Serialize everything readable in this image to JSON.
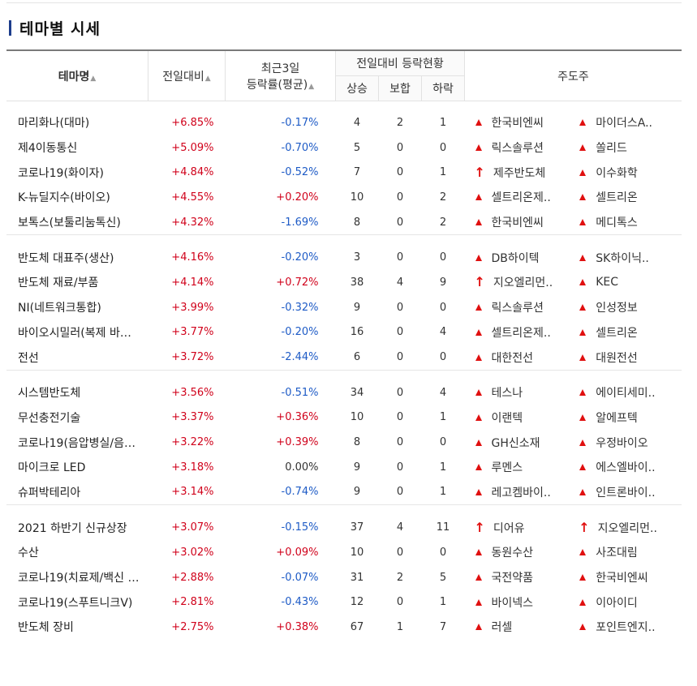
{
  "title": "테마별 시세",
  "header": {
    "theme": "테마명",
    "change": "전일대비",
    "rate3d_line1": "최근3일",
    "rate3d_line2": "등락률(평균)",
    "group": "전일대비 등락현황",
    "up": "상승",
    "same": "보합",
    "down": "하락",
    "leaders": "주도주",
    "sort_glyph": "▲"
  },
  "colors": {
    "up": "#d0021b",
    "down": "#1e5bc6",
    "accent": "#1d3d8c"
  },
  "groups": [
    [
      {
        "theme": "마리화나(대마)",
        "change": "+6.85%",
        "rate3d": "-0.17%",
        "up": "4",
        "same": "2",
        "down": "1",
        "leaders": [
          {
            "name": "한국비엔씨",
            "icon": "rise-icon"
          },
          {
            "name": "마이더스A..",
            "icon": "rise-icon"
          }
        ]
      },
      {
        "theme": "제4이동통신",
        "change": "+5.09%",
        "rate3d": "-0.70%",
        "up": "5",
        "same": "0",
        "down": "0",
        "leaders": [
          {
            "name": "릭스솔루션",
            "icon": "rise-icon"
          },
          {
            "name": "쏠리드",
            "icon": "rise-icon"
          }
        ]
      },
      {
        "theme": "코로나19(화이자)",
        "change": "+4.84%",
        "rate3d": "-0.52%",
        "up": "7",
        "same": "0",
        "down": "1",
        "leaders": [
          {
            "name": "제주반도체",
            "icon": "upper-limit-icon"
          },
          {
            "name": "이수화학",
            "icon": "rise-icon"
          }
        ]
      },
      {
        "theme": "K-뉴딜지수(바이오)",
        "change": "+4.55%",
        "rate3d": "+0.20%",
        "up": "10",
        "same": "0",
        "down": "2",
        "leaders": [
          {
            "name": "셀트리온제..",
            "icon": "rise-icon"
          },
          {
            "name": "셀트리온",
            "icon": "rise-icon"
          }
        ]
      },
      {
        "theme": "보톡스(보툴리눔톡신)",
        "change": "+4.32%",
        "rate3d": "-1.69%",
        "up": "8",
        "same": "0",
        "down": "2",
        "leaders": [
          {
            "name": "한국비엔씨",
            "icon": "rise-icon"
          },
          {
            "name": "메디톡스",
            "icon": "rise-icon"
          }
        ]
      }
    ],
    [
      {
        "theme": "반도체 대표주(생산)",
        "change": "+4.16%",
        "rate3d": "-0.20%",
        "up": "3",
        "same": "0",
        "down": "0",
        "leaders": [
          {
            "name": "DB하이텍",
            "icon": "rise-icon"
          },
          {
            "name": "SK하이닉..",
            "icon": "rise-icon"
          }
        ]
      },
      {
        "theme": "반도체 재료/부품",
        "change": "+4.14%",
        "rate3d": "+0.72%",
        "up": "38",
        "same": "4",
        "down": "9",
        "leaders": [
          {
            "name": "지오엘리먼..",
            "icon": "upper-limit-icon"
          },
          {
            "name": "KEC",
            "icon": "rise-icon"
          }
        ]
      },
      {
        "theme": "NI(네트워크통합)",
        "change": "+3.99%",
        "rate3d": "-0.32%",
        "up": "9",
        "same": "0",
        "down": "0",
        "leaders": [
          {
            "name": "릭스솔루션",
            "icon": "rise-icon"
          },
          {
            "name": "인성정보",
            "icon": "rise-icon"
          }
        ]
      },
      {
        "theme": "바이오시밀러(복제 바…",
        "change": "+3.77%",
        "rate3d": "-0.20%",
        "up": "16",
        "same": "0",
        "down": "4",
        "leaders": [
          {
            "name": "셀트리온제..",
            "icon": "rise-icon"
          },
          {
            "name": "셀트리온",
            "icon": "rise-icon"
          }
        ]
      },
      {
        "theme": "전선",
        "change": "+3.72%",
        "rate3d": "-2.44%",
        "up": "6",
        "same": "0",
        "down": "0",
        "leaders": [
          {
            "name": "대한전선",
            "icon": "rise-icon"
          },
          {
            "name": "대원전선",
            "icon": "rise-icon"
          }
        ]
      }
    ],
    [
      {
        "theme": "시스템반도체",
        "change": "+3.56%",
        "rate3d": "-0.51%",
        "up": "34",
        "same": "0",
        "down": "4",
        "leaders": [
          {
            "name": "테스나",
            "icon": "rise-icon"
          },
          {
            "name": "에이티세미..",
            "icon": "rise-icon"
          }
        ]
      },
      {
        "theme": "무선충전기술",
        "change": "+3.37%",
        "rate3d": "+0.36%",
        "up": "10",
        "same": "0",
        "down": "1",
        "leaders": [
          {
            "name": "이랜텍",
            "icon": "rise-icon"
          },
          {
            "name": "알에프텍",
            "icon": "rise-icon"
          }
        ]
      },
      {
        "theme": "코로나19(음압병실/음…",
        "change": "+3.22%",
        "rate3d": "+0.39%",
        "up": "8",
        "same": "0",
        "down": "0",
        "leaders": [
          {
            "name": "GH신소재",
            "icon": "rise-icon"
          },
          {
            "name": "우정바이오",
            "icon": "rise-icon"
          }
        ]
      },
      {
        "theme": "마이크로 LED",
        "change": "+3.18%",
        "rate3d": "0.00%",
        "up": "9",
        "same": "0",
        "down": "1",
        "leaders": [
          {
            "name": "루멘스",
            "icon": "rise-icon"
          },
          {
            "name": "에스엘바이..",
            "icon": "rise-icon"
          }
        ]
      },
      {
        "theme": "슈퍼박테리아",
        "change": "+3.14%",
        "rate3d": "-0.74%",
        "up": "9",
        "same": "0",
        "down": "1",
        "leaders": [
          {
            "name": "레고켐바이..",
            "icon": "rise-icon"
          },
          {
            "name": "인트론바이..",
            "icon": "rise-icon"
          }
        ]
      }
    ],
    [
      {
        "theme": "2021 하반기 신규상장",
        "change": "+3.07%",
        "rate3d": "-0.15%",
        "up": "37",
        "same": "4",
        "down": "11",
        "leaders": [
          {
            "name": "디어유",
            "icon": "upper-limit-icon"
          },
          {
            "name": "지오엘리먼..",
            "icon": "upper-limit-icon"
          }
        ]
      },
      {
        "theme": "수산",
        "change": "+3.02%",
        "rate3d": "+0.09%",
        "up": "10",
        "same": "0",
        "down": "0",
        "leaders": [
          {
            "name": "동원수산",
            "icon": "rise-icon"
          },
          {
            "name": "사조대림",
            "icon": "rise-icon"
          }
        ]
      },
      {
        "theme": "코로나19(치료제/백신 …",
        "change": "+2.88%",
        "rate3d": "-0.07%",
        "up": "31",
        "same": "2",
        "down": "5",
        "leaders": [
          {
            "name": "국전약품",
            "icon": "rise-icon"
          },
          {
            "name": "한국비엔씨",
            "icon": "rise-icon"
          }
        ]
      },
      {
        "theme": "코로나19(스푸트니크V)",
        "change": "+2.81%",
        "rate3d": "-0.43%",
        "up": "12",
        "same": "0",
        "down": "1",
        "leaders": [
          {
            "name": "바이넥스",
            "icon": "rise-icon"
          },
          {
            "name": "이아이디",
            "icon": "rise-icon"
          }
        ]
      },
      {
        "theme": "반도체 장비",
        "change": "+2.75%",
        "rate3d": "+0.38%",
        "up": "67",
        "same": "1",
        "down": "7",
        "leaders": [
          {
            "name": "러셀",
            "icon": "rise-icon"
          },
          {
            "name": "포인트엔지..",
            "icon": "rise-icon"
          }
        ]
      }
    ]
  ]
}
